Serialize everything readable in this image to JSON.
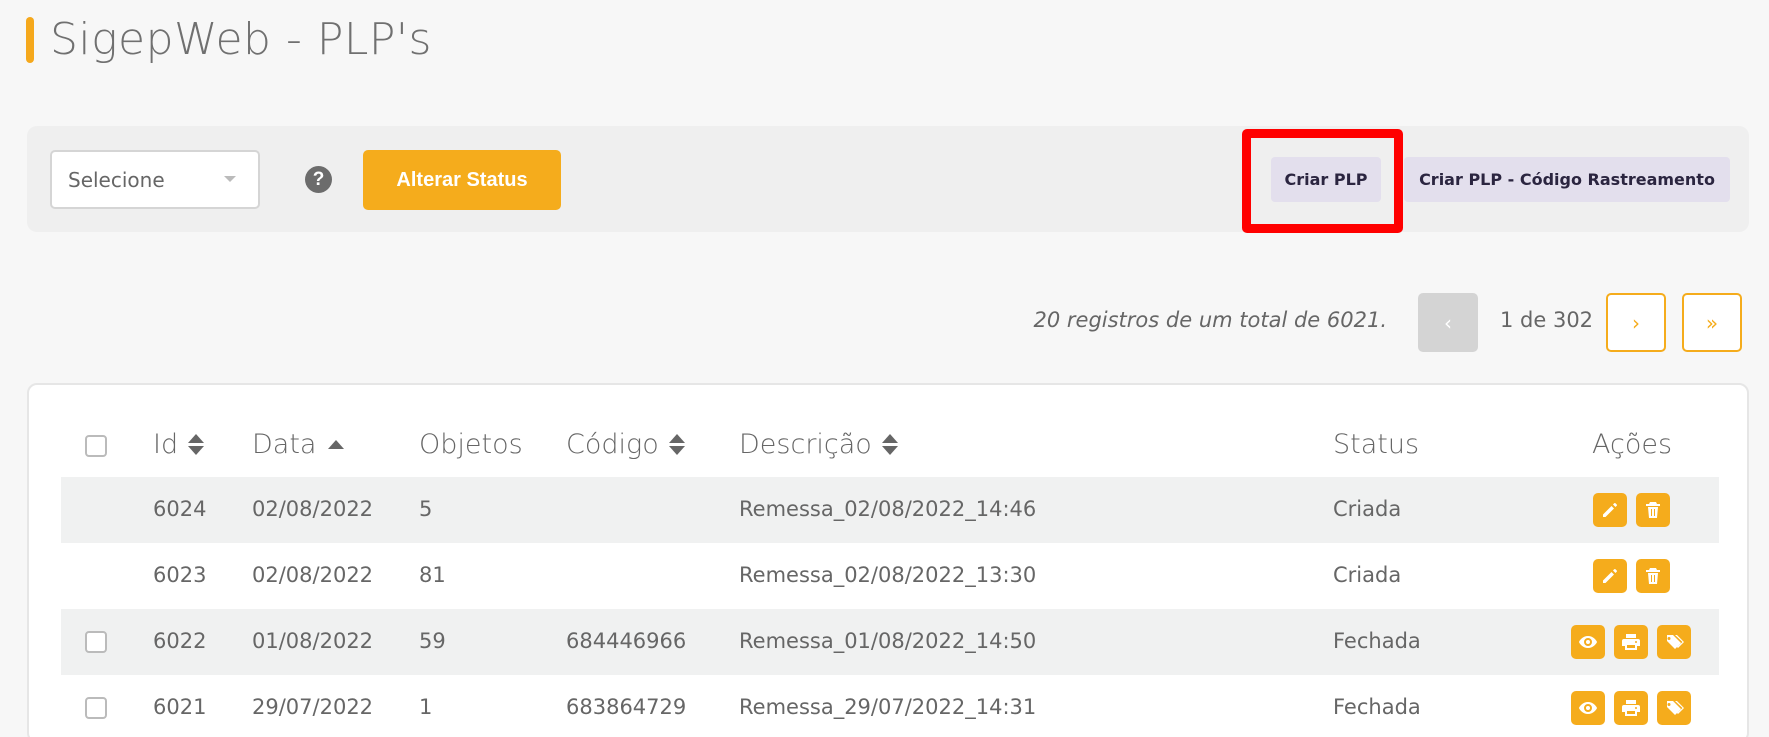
{
  "page": {
    "title": "SigepWeb - PLP's"
  },
  "toolbar": {
    "select_value": "Selecione",
    "help_glyph": "?",
    "alterar_status_label": "Alterar Status",
    "criar_plp_label": "Criar PLP",
    "criar_plp_rastreio_label": "Criar PLP - Código Rastreamento"
  },
  "pager": {
    "summary": "20 registros de um total de 6021.",
    "page": "1 de 302",
    "prev_glyph": "‹",
    "next_glyph": "›",
    "last_glyph": "»"
  },
  "table": {
    "headers": {
      "id": "Id",
      "data": "Data",
      "objetos": "Objetos",
      "codigo": "Código",
      "descricao": "Descrição",
      "status": "Status",
      "acoes": "Ações"
    },
    "rows": [
      {
        "id": "6024",
        "data": "02/08/2022",
        "objetos": "5",
        "codigo": "",
        "descricao": "Remessa_02/08/2022_14:46",
        "status": "Criada"
      },
      {
        "id": "6023",
        "data": "02/08/2022",
        "objetos": "81",
        "codigo": "",
        "descricao": "Remessa_02/08/2022_13:30",
        "status": "Criada"
      },
      {
        "id": "6022",
        "data": "01/08/2022",
        "objetos": "59",
        "codigo": "684446966",
        "descricao": "Remessa_01/08/2022_14:50",
        "status": "Fechada"
      },
      {
        "id": "6021",
        "data": "29/07/2022",
        "objetos": "1",
        "codigo": "683864729",
        "descricao": "Remessa_29/07/2022_14:31",
        "status": "Fechada"
      }
    ]
  },
  "colors": {
    "accent": "#f5ac1c",
    "lilac": "#e3dfed",
    "highlight": "#ff0000"
  }
}
